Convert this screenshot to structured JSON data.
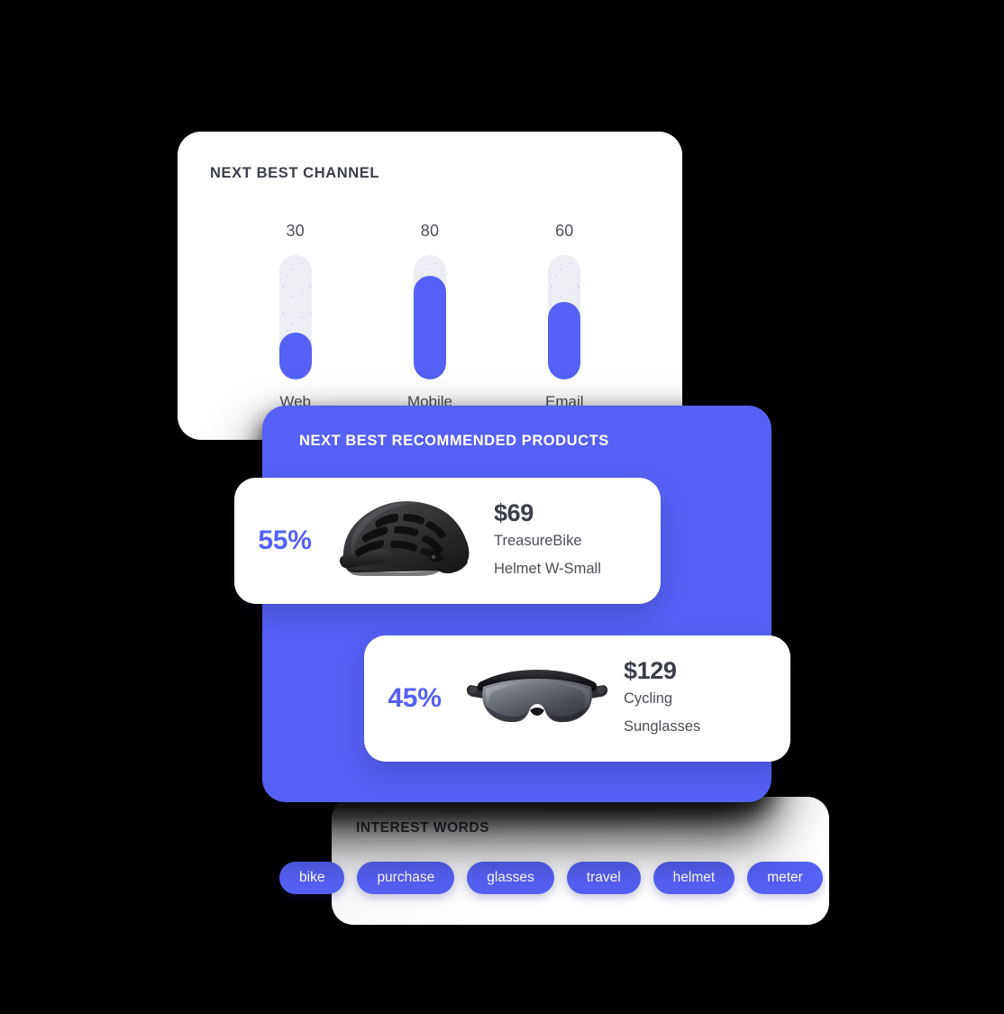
{
  "channel_card": {
    "title": "NEXT BEST CHANNEL"
  },
  "products_card": {
    "title": "NEXT BEST RECOMMENDED PRODUCTS",
    "items": [
      {
        "percent": "55%",
        "price": "$69",
        "name_line1": "TreasureBike",
        "name_line2": "Helmet W-Small",
        "image": "bike-helmet-image"
      },
      {
        "percent": "45%",
        "price": "$129",
        "name_line1": "Cycling",
        "name_line2": "Sunglasses",
        "image": "cycling-sunglasses-image"
      }
    ]
  },
  "interest_card": {
    "title": "INTEREST WORDS",
    "pills": [
      "bike",
      "purchase",
      "glasses",
      "travel",
      "helmet",
      "meter"
    ]
  },
  "colors": {
    "accent_blue": "#5561f5",
    "track_gray": "#eceef4",
    "text_dark": "#3b3f47",
    "text_body": "#4b4f57",
    "card_white": "#ffffff",
    "background": "#000000"
  },
  "chart_data": {
    "type": "bar",
    "title": "NEXT BEST CHANNEL",
    "categories": [
      "Web",
      "Mobile",
      "Email"
    ],
    "values": [
      30,
      80,
      60
    ],
    "value_labels": [
      "30",
      "80",
      "60"
    ],
    "xlabel": "",
    "ylabel": "",
    "ylim": [
      0,
      100
    ],
    "grid": false,
    "legend": "none",
    "orientation": "vertical",
    "style": "rounded-track-fill",
    "fill_fractions": [
      0.38,
      0.83,
      0.62
    ]
  }
}
